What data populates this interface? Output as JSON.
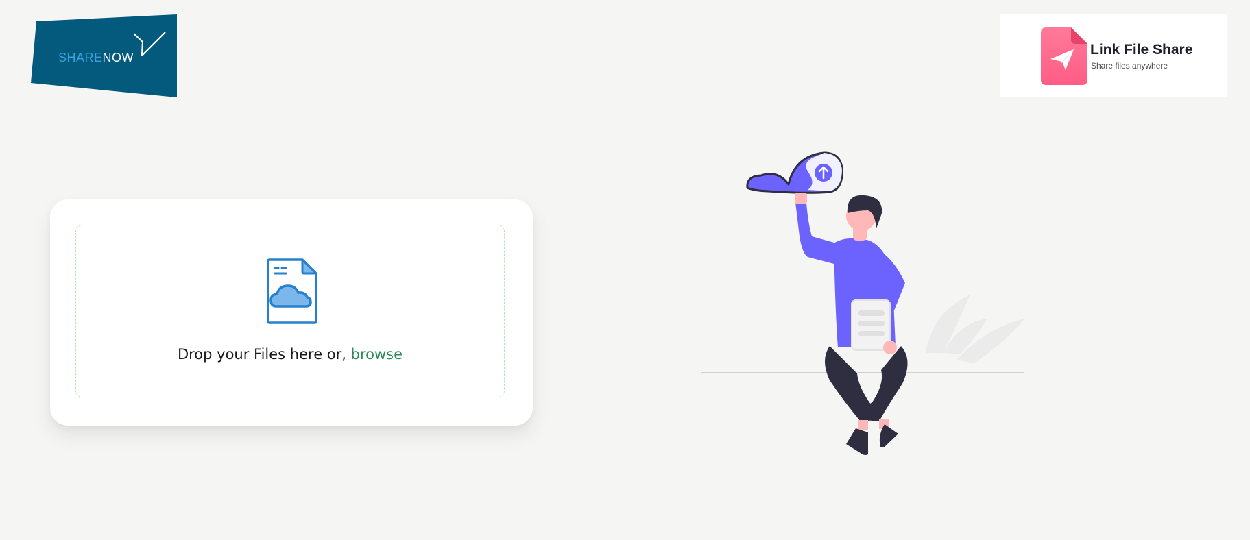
{
  "header": {
    "left_logo": {
      "word_accent": "SHARE",
      "word_rest": "NOW",
      "background_color": "#035a7c",
      "accent_color": "#3aa0dd"
    },
    "right_logo": {
      "title": "Link File Share",
      "tagline": "Share files anywhere",
      "badge_color": "#ff6a8a"
    }
  },
  "upload": {
    "prompt_text": "Drop your Files here or,",
    "browse_label": "browse",
    "icon": "file-cloud-icon",
    "accent_color": "#2e8b57",
    "dropzone_border_color": "#a8e6b4"
  },
  "illustration": {
    "subject": "person-holding-cloud-upload",
    "cloud_color": "#6c63ff",
    "icon": "upload-arrow-icon"
  }
}
